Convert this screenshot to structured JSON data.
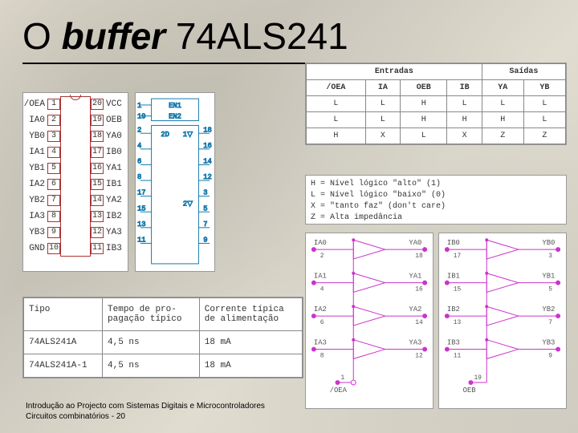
{
  "title": {
    "prefix": "O ",
    "italic": "buffer",
    "rest": " 74ALS241"
  },
  "chip": {
    "left": [
      "/OEA",
      "IA0",
      "YB0",
      "IA1",
      "YB1",
      "IA2",
      "YB2",
      "IA3",
      "YB3",
      "GND"
    ],
    "leftPins": [
      "1",
      "2",
      "3",
      "4",
      "5",
      "6",
      "7",
      "8",
      "9",
      "10"
    ],
    "rightPins": [
      "20",
      "19",
      "18",
      "17",
      "16",
      "15",
      "14",
      "13",
      "12",
      "11"
    ],
    "right": [
      "VCC",
      "OEB",
      "YA0",
      "IB0",
      "YA1",
      "IB1",
      "YA2",
      "IB2",
      "YA3",
      "IB3"
    ]
  },
  "symbol": {
    "en1": "EN1",
    "en2": "EN2",
    "leftTop": [
      "1",
      "19"
    ],
    "leftA": [
      "2",
      "4",
      "6",
      "8",
      "17",
      "15",
      "13",
      "11"
    ],
    "rightA": [
      "18",
      "16",
      "14",
      "12",
      "3",
      "5",
      "7",
      "9"
    ],
    "midTop": "2D",
    "invTop": "1▽",
    "invBot": "2▽"
  },
  "truth": {
    "hEntradas": "Entradas",
    "hSaidas": "Saídas",
    "cols": [
      "/OEA",
      "IA",
      "OEB",
      "IB",
      "YA",
      "YB"
    ],
    "rows": [
      [
        "L",
        "L",
        "H",
        "L",
        "L",
        "L"
      ],
      [
        "L",
        "L",
        "H",
        "H",
        "H",
        "L"
      ],
      [
        "H",
        "X",
        "L",
        "X",
        "Z",
        "Z"
      ]
    ]
  },
  "legend": {
    "l1": "H = Nível lógico \"alto\" (1)",
    "l2": "L = Nível lógico \"baixo\" (0)",
    "l3": "X = \"tanto faz\" (don't care)",
    "l4": "Z = Alta impedância"
  },
  "buffers": {
    "A": {
      "in": [
        "IA0",
        "IA1",
        "IA2",
        "IA3"
      ],
      "out": [
        "YA0",
        "YA1",
        "YA2",
        "YA3"
      ],
      "pinsIn": [
        "2",
        "4",
        "6",
        "8"
      ],
      "pinsOut": [
        "18",
        "16",
        "14",
        "12"
      ],
      "oe": "/OEA",
      "oePin": "1"
    },
    "B": {
      "in": [
        "IB0",
        "IB1",
        "IB2",
        "IB3"
      ],
      "out": [
        "YB0",
        "YB1",
        "YB2",
        "YB3"
      ],
      "pinsIn": [
        "17",
        "15",
        "13",
        "11"
      ],
      "pinsOut": [
        "3",
        "5",
        "7",
        "9"
      ],
      "oe": "OEB",
      "oePin": "19"
    }
  },
  "specs": {
    "h1": "Tipo",
    "h2": "Tempo de pro-\npagação típico",
    "h3": "Corrente típica\nde alimentação",
    "rows": [
      [
        "74ALS241A",
        "4,5 ns",
        "18 mA"
      ],
      [
        "74ALS241A-1",
        "4,5 ns",
        "18 mA"
      ]
    ]
  },
  "footer": {
    "l1": "Introdução ao Projecto com Sistemas Digitais e Microcontroladores",
    "l2": "Circuitos combinatórios - 20"
  }
}
